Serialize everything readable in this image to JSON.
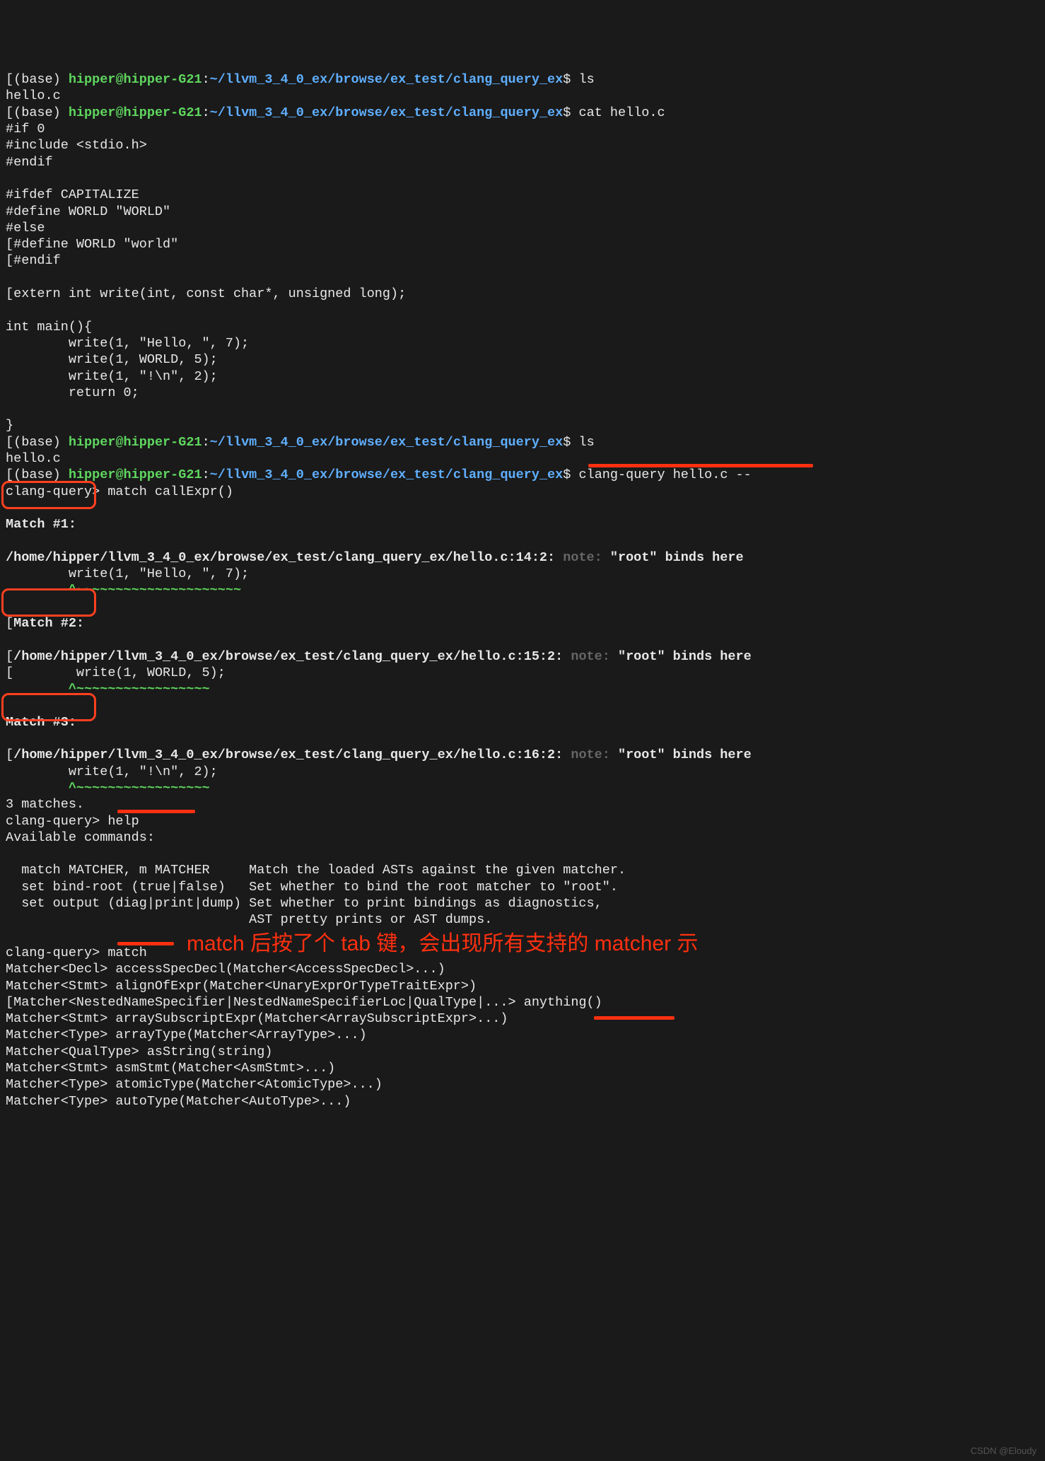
{
  "prompt1": {
    "base": "(base) ",
    "user": "hipper@hipper-G21",
    "colon": ":",
    "path": "~/llvm_3_4_0_ex/browse/ex_test/clang_query_ex",
    "sym": "$ ",
    "cmd": "ls"
  },
  "out1": "hello.c",
  "prompt2": {
    "base": "(base) ",
    "user": "hipper@hipper-G21",
    "colon": ":",
    "path": "~/llvm_3_4_0_ex/browse/ex_test/clang_query_ex",
    "sym": "$ ",
    "cmd": "cat hello.c"
  },
  "src": [
    "#if 0",
    "#include <stdio.h>",
    "#endif",
    "",
    "#ifdef CAPITALIZE",
    "#define WORLD \"WORLD\"",
    "#else",
    "#define WORLD \"world\"",
    "#endif",
    "",
    "extern int write(int, const char*, unsigned long);",
    "",
    "int main(){",
    "        write(1, \"Hello, \", 7);",
    "        write(1, WORLD, 5);",
    "        write(1, \"!\\n\", 2);",
    "        return 0;",
    "",
    "}"
  ],
  "prompt3": {
    "base": "(base) ",
    "user": "hipper@hipper-G21",
    "colon": ":",
    "path": "~/llvm_3_4_0_ex/browse/ex_test/clang_query_ex",
    "sym": "$ ",
    "cmd": "ls"
  },
  "out3": "hello.c",
  "prompt4": {
    "base": "(base) ",
    "user": "hipper@hipper-G21",
    "colon": ":",
    "path": "~/llvm_3_4_0_ex/browse/ex_test/clang_query_ex",
    "sym": "$ ",
    "cmd": "clang-query hello.c --"
  },
  "cq1": "clang-query> match callExpr()",
  "matches": [
    {
      "title": "Match #1:",
      "file": "/home/hipper/llvm_3_4_0_ex/browse/ex_test/clang_query_ex/hello.c:14:2:",
      "note": " note: ",
      "msg": "\"root\" binds here",
      "code": "        write(1, \"Hello, \", 7);",
      "carets": "        ^~~~~~~~~~~~~~~~~~~~~~"
    },
    {
      "title": "Match #2:",
      "file": "/home/hipper/llvm_3_4_0_ex/browse/ex_test/clang_query_ex/hello.c:15:2:",
      "note": " note: ",
      "msg": "\"root\" binds here",
      "code": "        write(1, WORLD, 5);",
      "carets": "        ^~~~~~~~~~~~~~~~~~"
    },
    {
      "title": "Match #3:",
      "file": "/home/hipper/llvm_3_4_0_ex/browse/ex_test/clang_query_ex/hello.c:16:2:",
      "note": " note: ",
      "msg": "\"root\" binds here",
      "code": "        write(1, \"!\\n\", 2);",
      "carets": "        ^~~~~~~~~~~~~~~~~~"
    }
  ],
  "matchcount": "3 matches.",
  "cq2": "clang-query> help",
  "help": {
    "header": "Available commands:",
    "lines": [
      "  match MATCHER, m MATCHER     Match the loaded ASTs against the given matcher.",
      "  set bind-root (true|false)   Set whether to bind the root matcher to \"root\".",
      "  set output (diag|print|dump) Set whether to print bindings as diagnostics,",
      "                               AST pretty prints or AST dumps."
    ]
  },
  "cq3": "clang-query> match ",
  "annot": "match 后按了个 tab 键，会出现所有支持的 matcher 示",
  "matchers": [
    "Matcher<Decl> accessSpecDecl(Matcher<AccessSpecDecl>...)",
    "Matcher<Stmt> alignOfExpr(Matcher<UnaryExprOrTypeTraitExpr>)",
    "Matcher<NestedNameSpecifier|NestedNameSpecifierLoc|QualType|...> anything()",
    "Matcher<Stmt> arraySubscriptExpr(Matcher<ArraySubscriptExpr>...)",
    "Matcher<Type> arrayType(Matcher<ArrayType>...)",
    "Matcher<QualType> asString(string)",
    "Matcher<Stmt> asmStmt(Matcher<AsmStmt>...)",
    "Matcher<Type> atomicType(Matcher<AtomicType>...)",
    "Matcher<Type> autoType(Matcher<AutoType>...)"
  ],
  "watermark": "CSDN @Eloudy"
}
